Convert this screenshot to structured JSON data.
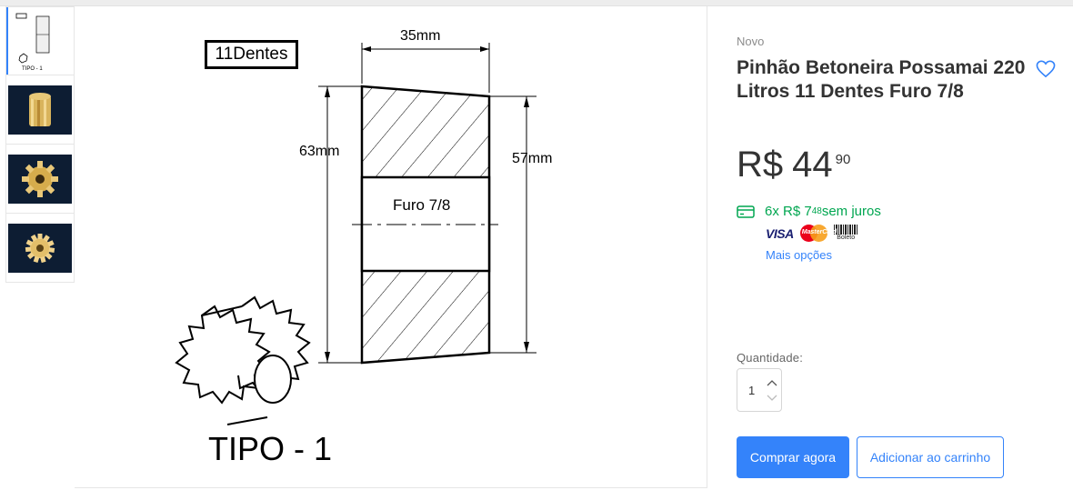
{
  "gallery": {
    "thumbnails": [
      {
        "alt": "technical drawing thumbnail",
        "caption": "TIPO - 1"
      },
      {
        "alt": "brass pinion side view"
      },
      {
        "alt": "brass pinion angled view"
      },
      {
        "alt": "brass pinion top view"
      }
    ],
    "main_drawing": {
      "teeth_label": "11Dentes",
      "width_label": "35mm",
      "left_height_label": "63mm",
      "right_height_label": "57mm",
      "bore_label": "Furo 7/8",
      "type_label": "TIPO - 1"
    }
  },
  "product": {
    "condition": "Novo",
    "title": "Pinhão Betoneira Possamai 220 Litros 11 Dentes Furo 7/8",
    "price": {
      "currency": "R$",
      "integer": "44",
      "cents": "90"
    },
    "installments": {
      "prefix": "6x R$ 7",
      "cents": "48",
      "suffix": " sem juros"
    },
    "payment_methods": [
      "VISA",
      "MasterCard",
      "Boleto"
    ],
    "more_options": "Mais opções",
    "quantity_label": "Quantidade:",
    "quantity_value": "1",
    "buy_now": "Comprar agora",
    "add_to_cart": "Adicionar ao carrinho"
  },
  "colors": {
    "accent": "#3483fa",
    "green": "#00a650",
    "text": "#333333"
  },
  "icons": [
    "heart-icon",
    "credit-card-icon",
    "chevron-up-icon",
    "chevron-down-icon"
  ]
}
